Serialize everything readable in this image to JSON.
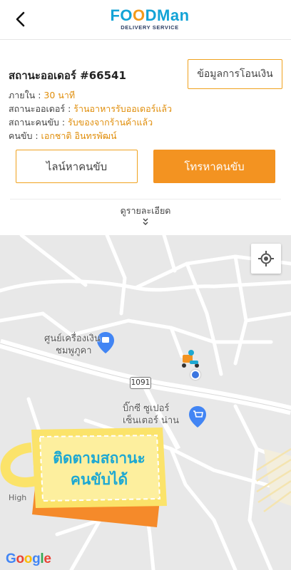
{
  "header": {
    "back_icon": "chevron-left-icon",
    "logo_brand_prefix": "FO",
    "logo_brand_o": "O",
    "logo_brand_suffix": "DMan",
    "logo_tagline": "DELIVERY SERVICE"
  },
  "order": {
    "title": "สถานะออเดอร์ #66541",
    "transfer_button": "ข้อมูลการโอนเงิน",
    "info": [
      {
        "label": "ภายใน : ",
        "value": "30 นาที"
      },
      {
        "label": "สถานะออเดอร์ : ",
        "value": "ร้านอาหารรับออเดอร์แล้ว"
      },
      {
        "label": "สถานะคนขับ : ",
        "value": "รับของจากร้านค้าแล้ว"
      },
      {
        "label": "คนขับ : ",
        "value": "เอกชาติ อินทรพัฒน์"
      }
    ],
    "line_button": "ไลน์หาคนขับ",
    "call_button": "โทรหาคนขับ",
    "details_link": "ดูรายละเอียด"
  },
  "map": {
    "poi_atm": [
      "ศูนย์เครื่องเงิน",
      "ชมพูภูคา"
    ],
    "poi_market": [
      "บิ๊กซี ซูเปอร์",
      "เซ็นเตอร์ น่าน"
    ],
    "route_number": "1091",
    "road_label": "High",
    "google_letters": [
      "G",
      "o",
      "o",
      "g",
      "l",
      "e"
    ],
    "overlay_text": [
      "ติดตามสถานะ",
      "คนขับได้"
    ],
    "colors": {
      "accent": "#f39321",
      "overlay_text": "#1da8d2",
      "rider_dot": "#3b76e0"
    }
  }
}
